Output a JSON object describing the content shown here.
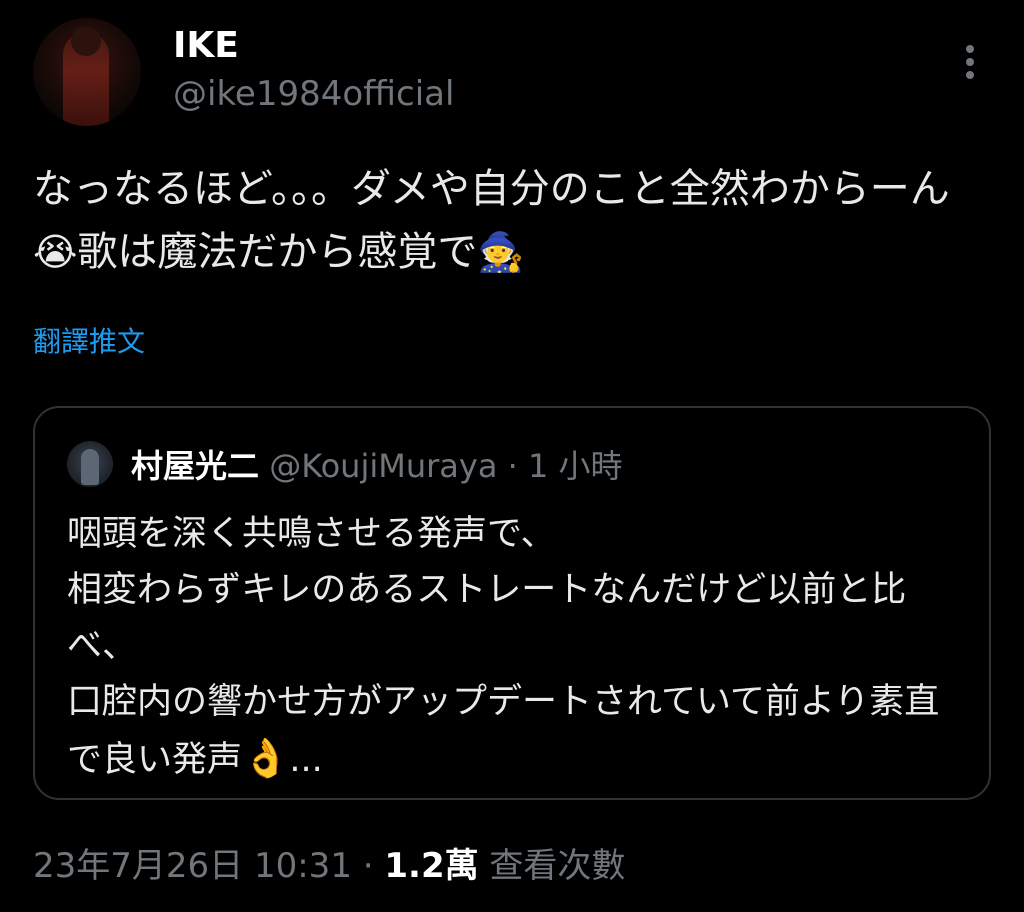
{
  "author": {
    "display_name": "IKE",
    "handle": "@ike1984official"
  },
  "tweet": {
    "text_main": "なっなるほど。。。ダメや自分のこと全然わからーん",
    "emoji_1": "😭",
    "text_after": "歌は魔法だから感覚で",
    "emoji_2": "🧙"
  },
  "translate_label": "翻譯推文",
  "quote": {
    "display_name": "村屋光二",
    "handle": "@KoujiMuraya",
    "separator": " · ",
    "time": "1 小時",
    "text_main": "咽頭を深く共鳴させる発声で、\n相変わらずキレのあるストレートなんだけど以前と比べ、\n口腔内の響かせ方がアップデートされていて前より素直で良い発声",
    "emoji": "👌",
    "ellipsis": "..."
  },
  "meta": {
    "timestamp": "23年7月26日 10:31",
    "separator": " · ",
    "views_count": "1.2萬",
    "views_label": " 查看次數"
  },
  "colors": {
    "background": "#000000",
    "text_primary": "#e7e9ea",
    "text_secondary": "#71767b",
    "link": "#1d9bf0",
    "border": "#2f3336"
  },
  "icons": {
    "more": "more-vertical-icon"
  }
}
